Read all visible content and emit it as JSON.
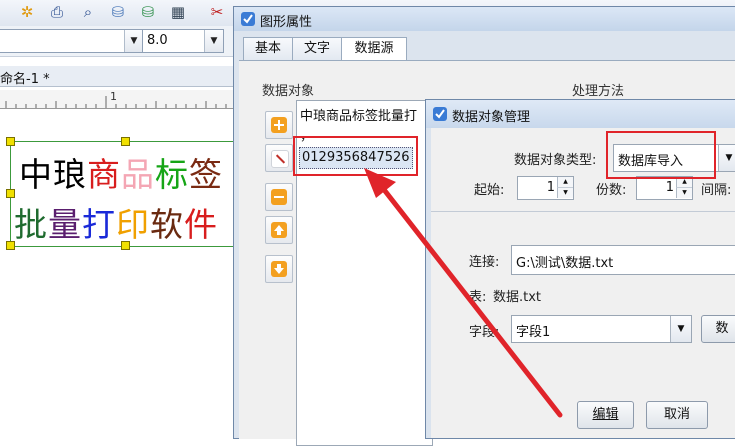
{
  "toolbar": {
    "icons": [
      "settings-icon",
      "print-icon",
      "preview-icon",
      "database-icon",
      "database-settings-icon",
      "grid-icon",
      "cut-icon"
    ],
    "font_size": "8.0"
  },
  "document": {
    "tab_label": "命名-1 *",
    "ruler_mark": "1"
  },
  "label": {
    "line1": [
      {
        "ch": "中",
        "color": "#000000"
      },
      {
        "ch": "琅",
        "color": "#000000"
      },
      {
        "ch": "商",
        "color": "#d81d1d"
      },
      {
        "ch": "品",
        "color": "#f4a6b4"
      },
      {
        "ch": "标",
        "color": "#16a516"
      },
      {
        "ch": "签",
        "color": "#7a2a12"
      }
    ],
    "line2": [
      {
        "ch": "批",
        "color": "#1f6b2f"
      },
      {
        "ch": "量",
        "color": "#5a1e6e"
      },
      {
        "ch": "打",
        "color": "#1a2ad8"
      },
      {
        "ch": "印",
        "color": "#f0a000"
      },
      {
        "ch": "软",
        "color": "#6a2a10"
      },
      {
        "ch": "件",
        "color": "#d81d1d"
      }
    ]
  },
  "graphic_properties": {
    "title": "图形属性",
    "tabs": [
      "基本",
      "文字",
      "数据源"
    ],
    "active_tab": 2,
    "data_objects_label": "数据对象",
    "processing_label": "处理方法",
    "list_items": [
      "中琅商品标签批量打",
      "，",
      "0129356847526"
    ]
  },
  "data_object_manager": {
    "title": "数据对象管理",
    "type_label": "数据对象类型:",
    "type_value": "数据库导入",
    "start_label": "起始:",
    "start_value": "1",
    "copies_label": "份数:",
    "copies_value": "1",
    "interval_label": "间隔:",
    "connection_label": "连接:",
    "connection_value": "G:\\测试\\数据.txt",
    "table_label": "表:",
    "table_value": "数据.txt",
    "field_label": "字段:",
    "field_value": "字段1",
    "data_button_label": "数",
    "edit_button_label": "编辑",
    "cancel_button_label": "取消"
  },
  "colors": {
    "annotation_red": "#e0242a",
    "selection_green": "#3c9a3c",
    "handle_yellow": "#f0e000"
  }
}
